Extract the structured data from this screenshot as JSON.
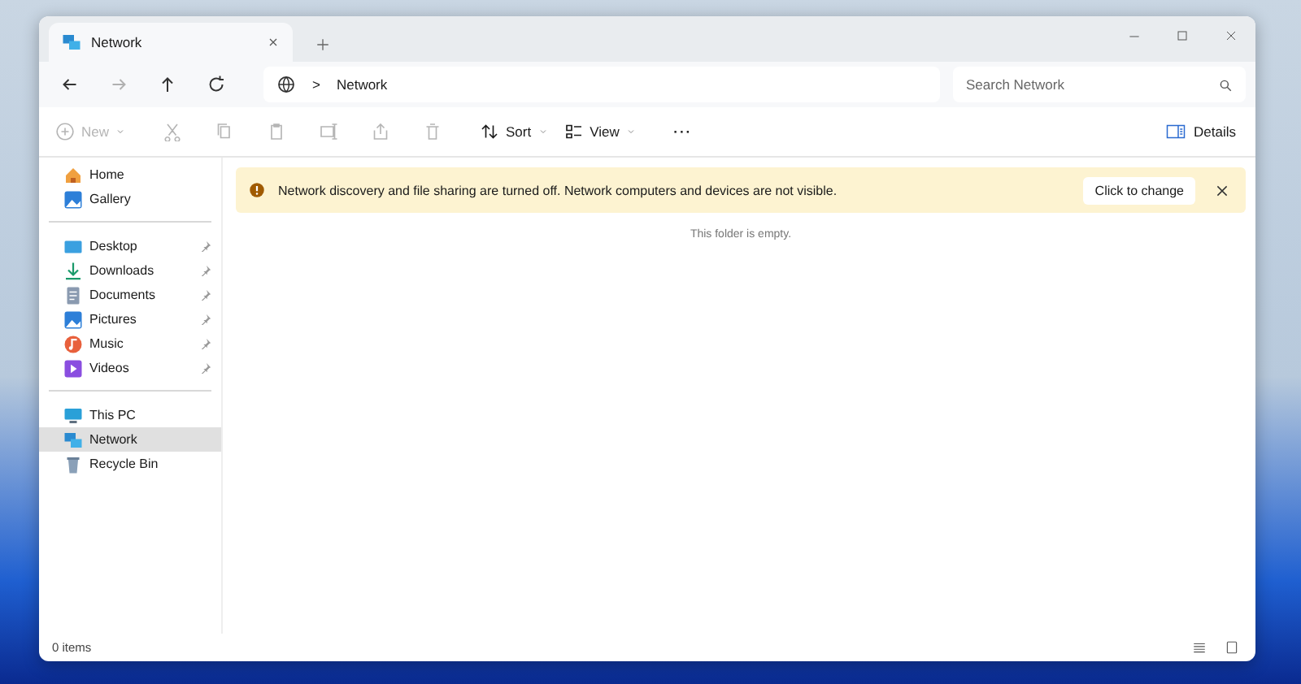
{
  "window": {
    "tab": {
      "title": "Network",
      "selected": true
    }
  },
  "navigation": {
    "buttons": [
      {
        "kind": "back",
        "disabled": false
      },
      {
        "kind": "forward",
        "disabled": true
      },
      {
        "kind": "up",
        "disabled": false
      },
      {
        "kind": "refresh",
        "disabled": false
      }
    ],
    "breadcrumb_separator": ">",
    "location": "Network",
    "search": {
      "placeholder": "Search Network"
    }
  },
  "toolbar": {
    "items": [
      {
        "kind": "new",
        "label": "New",
        "disabled": true
      },
      {
        "kind": "cut",
        "disabled": true
      },
      {
        "kind": "copy",
        "disabled": true
      },
      {
        "kind": "paste",
        "disabled": true
      },
      {
        "kind": "rename",
        "disabled": true
      },
      {
        "kind": "share",
        "disabled": true
      },
      {
        "kind": "delete",
        "disabled": true
      },
      {
        "kind": "sort",
        "label": "Sort",
        "disabled": false
      },
      {
        "kind": "view",
        "label": "View",
        "disabled": false
      },
      {
        "kind": "more",
        "label": "···",
        "disabled": false
      }
    ],
    "details": "Details"
  },
  "sidebar": {
    "groups": [
      [
        {
          "kind": "home",
          "label": "Home",
          "pinned": false,
          "selected": false
        },
        {
          "kind": "gallery",
          "label": "Gallery",
          "pinned": false,
          "selected": false
        }
      ],
      [
        {
          "kind": "desktop",
          "label": "Desktop",
          "pinned": true,
          "selected": false
        },
        {
          "kind": "downloads",
          "label": "Downloads",
          "pinned": true,
          "selected": false
        },
        {
          "kind": "documents",
          "label": "Documents",
          "pinned": true,
          "selected": false
        },
        {
          "kind": "pictures",
          "label": "Pictures",
          "pinned": true,
          "selected": false
        },
        {
          "kind": "music",
          "label": "Music",
          "pinned": true,
          "selected": false
        },
        {
          "kind": "videos",
          "label": "Videos",
          "pinned": true,
          "selected": false
        }
      ],
      [
        {
          "kind": "pc",
          "label": "This PC",
          "pinned": false,
          "selected": false
        },
        {
          "kind": "network",
          "label": "Network",
          "pinned": false,
          "selected": true
        },
        {
          "kind": "recycle",
          "label": "Recycle Bin",
          "pinned": false,
          "selected": false
        }
      ]
    ]
  },
  "banner": {
    "message": "Network discovery and file sharing are turned off. Network computers and devices are not visible.",
    "action": "Click to change"
  },
  "content": {
    "empty_message": "This folder is empty."
  },
  "status_bar": {
    "items": "0 items"
  }
}
